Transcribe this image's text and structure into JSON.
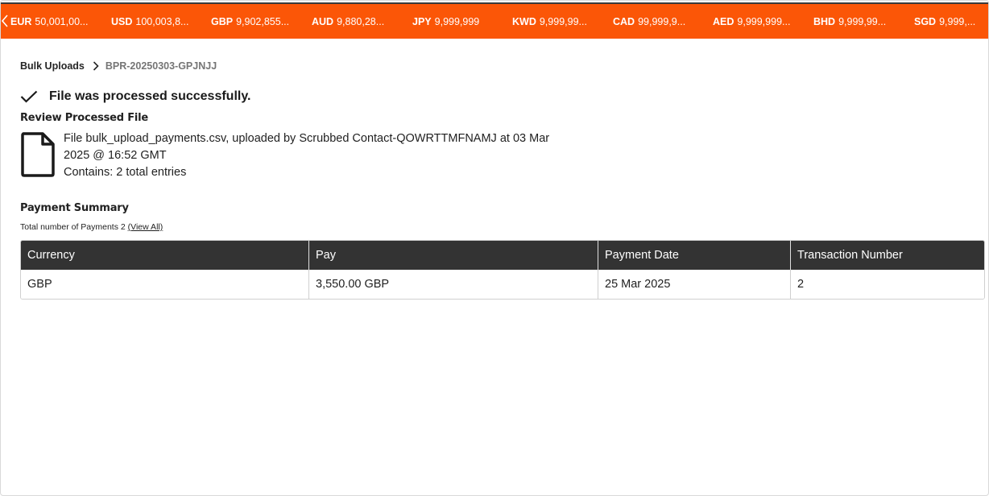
{
  "ticker": [
    {
      "code": "EUR",
      "amount": "50,001,00..."
    },
    {
      "code": "USD",
      "amount": "100,003,8..."
    },
    {
      "code": "GBP",
      "amount": "9,902,855..."
    },
    {
      "code": "AUD",
      "amount": "9,880,28..."
    },
    {
      "code": "JPY",
      "amount": "9,999,999"
    },
    {
      "code": "KWD",
      "amount": "9,999,99..."
    },
    {
      "code": "CAD",
      "amount": "99,999,9..."
    },
    {
      "code": "AED",
      "amount": "9,999,999..."
    },
    {
      "code": "BHD",
      "amount": "9,999,99..."
    },
    {
      "code": "SGD",
      "amount": "9,999,..."
    }
  ],
  "breadcrumb": {
    "parent": "Bulk Uploads",
    "current": "BPR-20250303-GPJNJJ"
  },
  "status": {
    "message": "File was processed successfully."
  },
  "review": {
    "title": "Review Processed File",
    "line1": "File bulk_upload_payments.csv, uploaded by Scrubbed Contact-QOWRTTMFNAMJ at 03 Mar",
    "line2": "2025 @ 16:52 GMT",
    "line3": "Contains: 2 total entries"
  },
  "summary": {
    "title": "Payment Summary",
    "count_text": "Total number of Payments 2",
    "view_all": "(View All)"
  },
  "table": {
    "headers": [
      "Currency",
      "Pay",
      "Payment Date",
      "Transaction Number"
    ],
    "rows": [
      [
        "GBP",
        "3,550.00 GBP",
        "25 Mar 2025",
        "2"
      ]
    ]
  },
  "colors": {
    "accent": "#fb5607",
    "header_bg": "#333333"
  },
  "icons": {
    "ticker_prev": "chevron-left-icon",
    "success": "checkmark-icon",
    "file": "file-icon"
  }
}
